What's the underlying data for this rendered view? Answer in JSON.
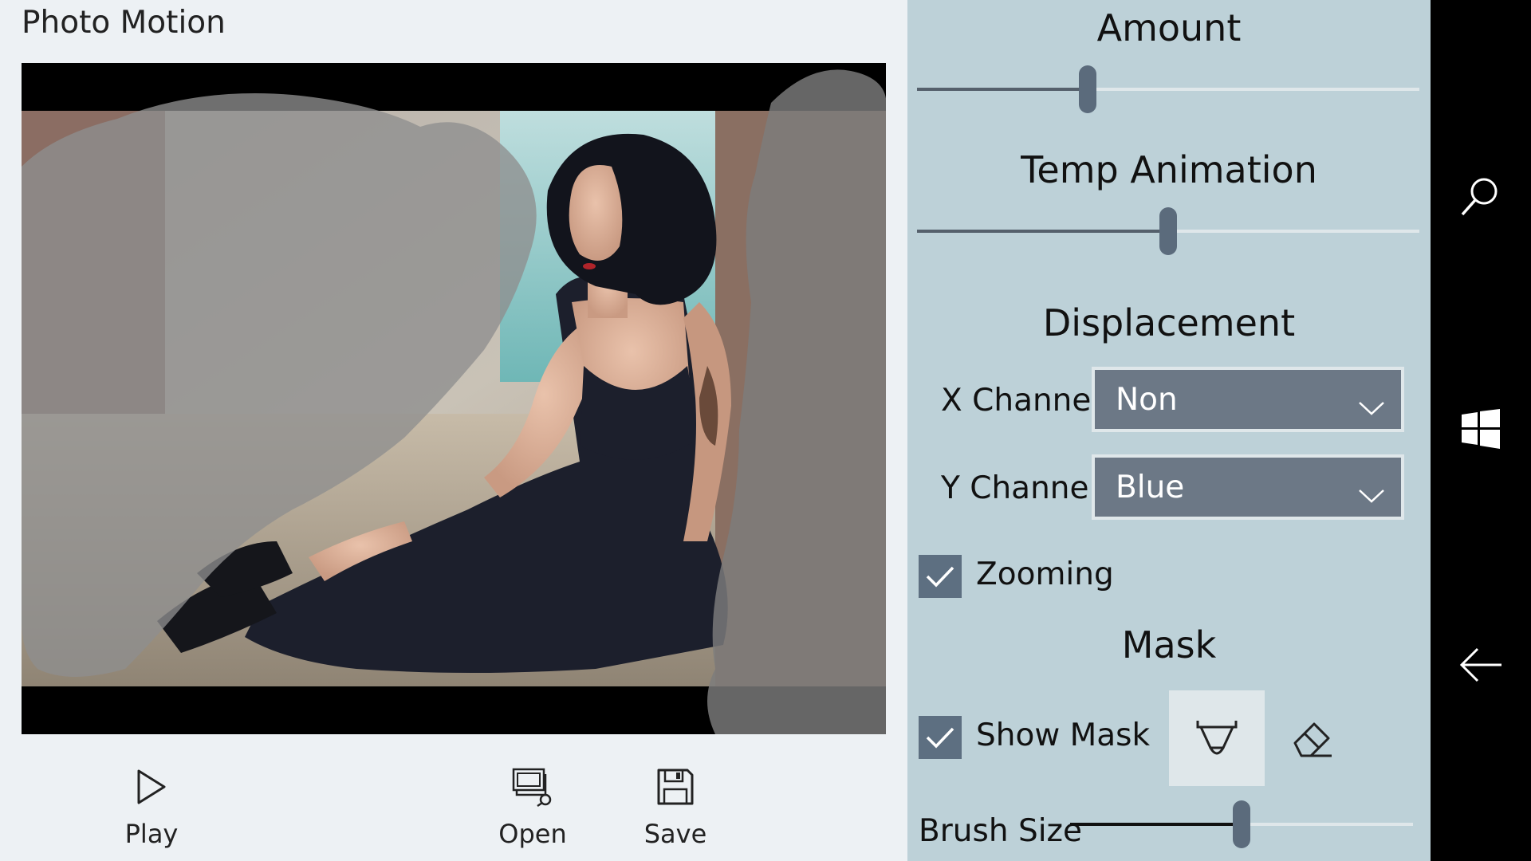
{
  "app": {
    "title": "Photo Motion"
  },
  "commands": {
    "play_label": "Play",
    "open_label": "Open",
    "save_label": "Save"
  },
  "settings": {
    "amount": {
      "title": "Amount",
      "value_fraction": 0.34
    },
    "temp_animation": {
      "title": "Temp Animation",
      "value_fraction": 0.5
    },
    "displacement": {
      "title": "Displacement",
      "x_channel": {
        "label": "X Channel",
        "value": "Non"
      },
      "y_channel": {
        "label": "Y Channel",
        "value": "Blue"
      }
    },
    "zooming": {
      "label": "Zooming",
      "checked": true
    },
    "mask": {
      "title": "Mask",
      "show_mask": {
        "label": "Show Mask",
        "checked": true
      },
      "active_tool": "brush-icon"
    },
    "brush_size": {
      "label": "Brush Size",
      "value_fraction": 0.5
    }
  },
  "icons": {
    "play": "play-icon",
    "open": "open-image-icon",
    "save": "floppy-disk-icon",
    "brush": "brush-icon",
    "eraser": "eraser-icon",
    "search": "search-icon",
    "windows": "windows-logo-icon",
    "back": "back-arrow-icon"
  },
  "colors": {
    "panel": "#bdd1d8",
    "accent": "#5d6f81",
    "select": "#6c7886",
    "background": "#edf1f4",
    "navbar": "#000000"
  }
}
